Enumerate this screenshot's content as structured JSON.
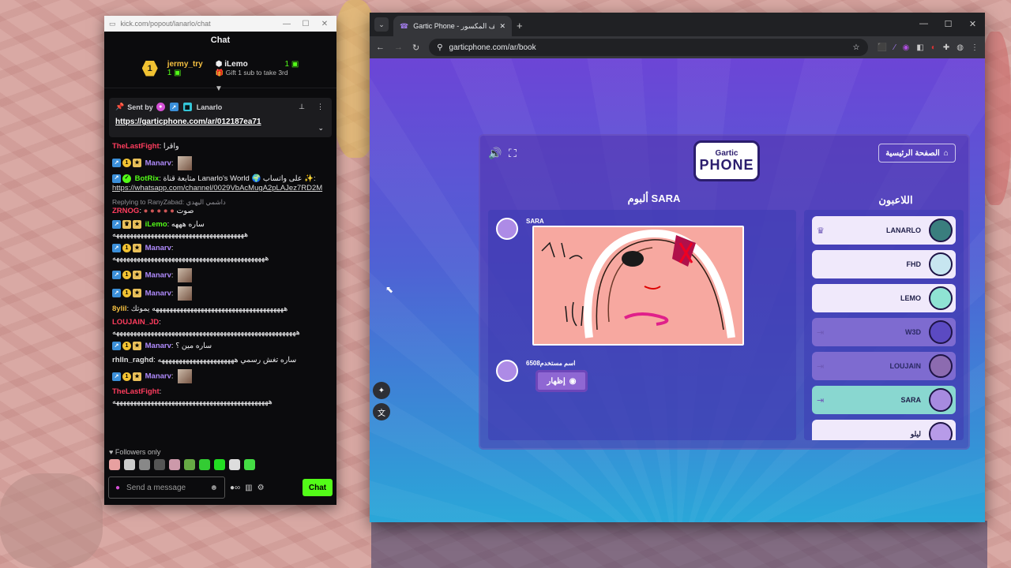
{
  "chat_window": {
    "url": "kick.com/popout/lanarlo/chat",
    "header": "Chat",
    "gifters": [
      {
        "rank": "1",
        "name": "jermy_try",
        "count": "1"
      },
      {
        "name": "iLemo",
        "count": "1",
        "sub": "Gift 1 sub to take 3rd"
      }
    ],
    "pinned": {
      "sent_by": "Sent by",
      "user": "Lanarlo",
      "link": "https://garticphone.com/ar/012187ea71"
    },
    "messages": [
      {
        "user": "TheLastFight",
        "color": "red",
        "text": "واقرا"
      },
      {
        "user": "Manarv",
        "color": "purple",
        "text": ""
      },
      {
        "user": "BotRix",
        "color": "green",
        "text": "متابعة قناة Lanarlo's World 🌍 على واتساب ✨: ",
        "link": "https://whatsapp.com/channel/0029VbAcMugA2pLAJez7RD2M"
      },
      {
        "reply": "Replying to RanyZabad: داشمي اليهدي",
        "user": "ZRNOG",
        "color": "red",
        "text": "صوت"
      },
      {
        "user": "iLemo",
        "color": "green",
        "text": "ساره هههه ههههههههههههههههههههههههههههههههههههههه"
      },
      {
        "user": "Manarv",
        "color": "purple",
        "text": "ههههههههههههههههههههههههههههههههههههههههههههه"
      },
      {
        "user": "Manarv",
        "color": "purple",
        "text": ""
      },
      {
        "user": "Manarv",
        "color": "purple",
        "text": ""
      },
      {
        "user": "8ylil",
        "color": "yellow",
        "text": "ههههههههههههههههههههههههههههههههههههههه يموتك"
      },
      {
        "user": "LOUJAIN_JD",
        "color": "red",
        "text": "هههههههههههههههههههههههههههههههههههههههههههههههههههههه"
      },
      {
        "user": "Manarv",
        "color": "purple",
        "text": "ساره مين ؟"
      },
      {
        "user": "rhlln_raghd",
        "color": "white",
        "text": "ساره تغش رسمي ههههههههههههههههههههههه"
      },
      {
        "user": "Manarv",
        "color": "purple",
        "text": ""
      },
      {
        "user": "TheLastFight",
        "color": "red",
        "text": "هههههههههههههههههههههههههههههههههههههههههههههه"
      }
    ],
    "followers_only": "Followers only",
    "input_placeholder": "Send a message",
    "chat_button": "Chat"
  },
  "browser": {
    "tab_title": "Gartic Phone - الهاتف المكسور",
    "url": "garticphone.com/ar/book"
  },
  "game": {
    "home_button": "الصفحة الرئيسية",
    "logo_top": "Gartic",
    "logo_main": "PHONE",
    "album_title": "ألبوم SARA",
    "players_title": "اللاعبون",
    "album_author": "SARA",
    "guest_name": "اسم مستخدم6508",
    "show_button": "إظهار",
    "players": [
      {
        "name": "LANARLO",
        "state": "host"
      },
      {
        "name": "FHD",
        "state": "on"
      },
      {
        "name": "LEMO",
        "state": "on"
      },
      {
        "name": "W3D",
        "state": "off"
      },
      {
        "name": "LOUJAIN",
        "state": "off"
      },
      {
        "name": "SARA",
        "state": "current"
      },
      {
        "name": "ليلو",
        "state": "on"
      }
    ]
  },
  "colors": {
    "kick_green": "#53fc18",
    "gartic_purple": "#6c45d6",
    "gartic_cyan": "#2aa7d8"
  }
}
